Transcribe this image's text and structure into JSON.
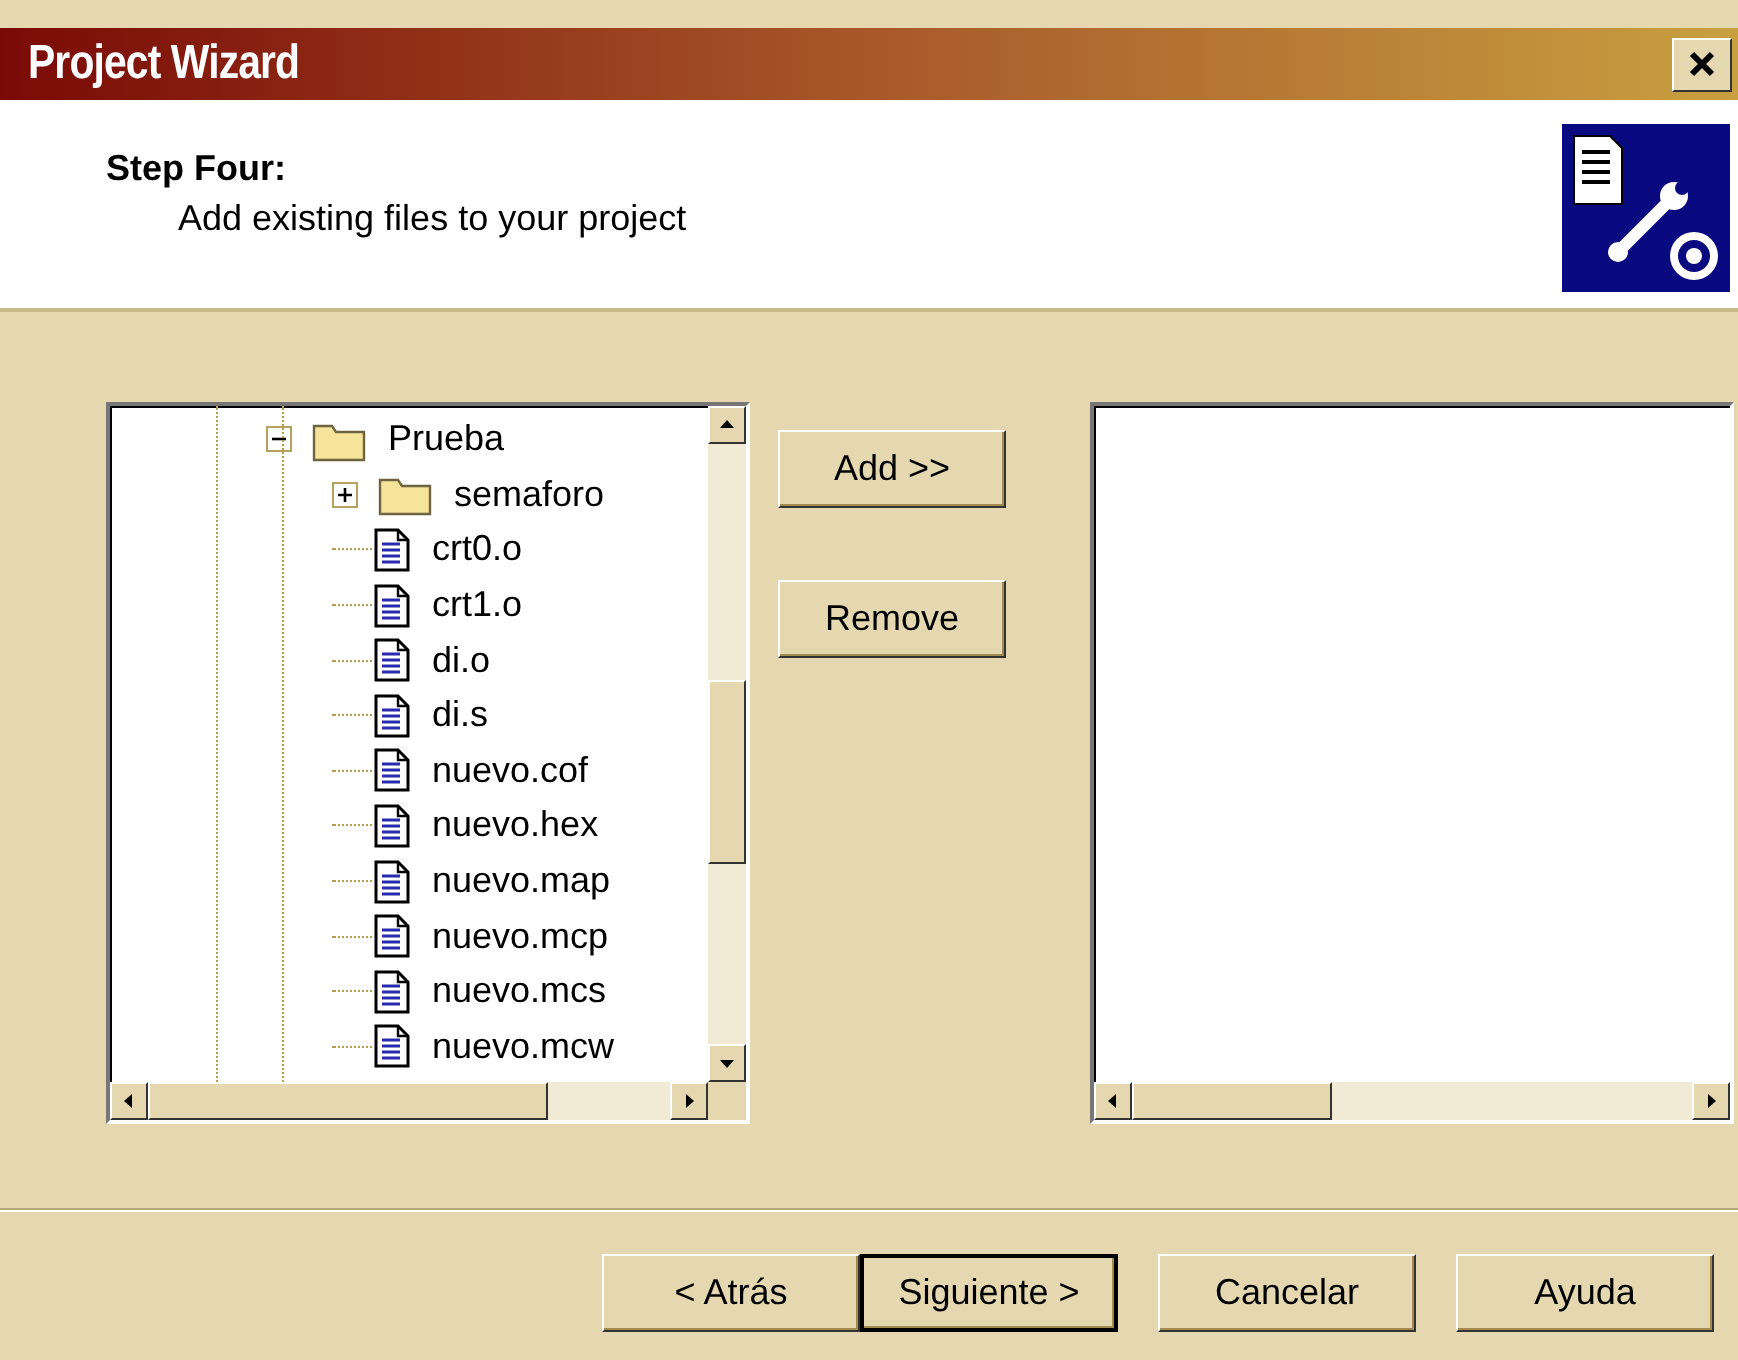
{
  "window": {
    "title": "Project Wizard"
  },
  "header": {
    "step": "Step Four:",
    "description": "Add existing files to your project"
  },
  "tree": [
    {
      "label": "Prueba",
      "kind": "folder",
      "expanded": true,
      "children": [
        {
          "label": "semaforo",
          "kind": "folder",
          "expanded": false
        },
        {
          "label": "crt0.o",
          "kind": "file"
        },
        {
          "label": "crt1.o",
          "kind": "file"
        },
        {
          "label": "di.o",
          "kind": "file"
        },
        {
          "label": "di.s",
          "kind": "file"
        },
        {
          "label": "nuevo.cof",
          "kind": "file"
        },
        {
          "label": "nuevo.hex",
          "kind": "file"
        },
        {
          "label": "nuevo.map",
          "kind": "file"
        },
        {
          "label": "nuevo.mcp",
          "kind": "file"
        },
        {
          "label": "nuevo.mcs",
          "kind": "file"
        },
        {
          "label": "nuevo.mcw",
          "kind": "file"
        }
      ]
    }
  ],
  "middle_buttons": [
    "Add >>",
    "Remove"
  ],
  "footer_buttons": [
    {
      "label": "< Atrás",
      "default": false
    },
    {
      "label": "Siguiente >",
      "default": true
    },
    {
      "label": "Cancelar",
      "default": false
    },
    {
      "label": "Ayuda",
      "default": false
    }
  ]
}
